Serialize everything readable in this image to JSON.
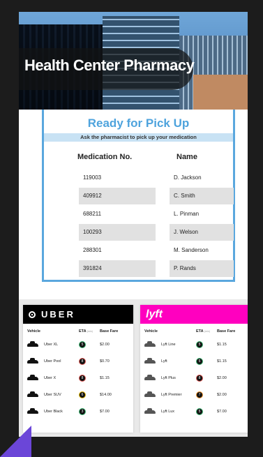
{
  "header": {
    "title": "Health Center Pharmacy"
  },
  "pickup": {
    "heading": "Ready for Pick Up",
    "instruction": "Ask the pharmacist to pick up your medication",
    "col_medication": "Medication No.",
    "col_name": "Name",
    "rows": [
      {
        "med": "119003",
        "name": "D. Jackson"
      },
      {
        "med": "409912",
        "name": "C. Smith"
      },
      {
        "med": "688211",
        "name": "L. Pinman"
      },
      {
        "med": "100293",
        "name": "J. Welson"
      },
      {
        "med": "288301",
        "name": "M. Sanderson"
      },
      {
        "med": "391824",
        "name": "P. Rands"
      }
    ]
  },
  "uber": {
    "brand": "UBER",
    "col_vehicle": "Vehicle",
    "col_eta": "ETA",
    "col_eta_unit": "(min)",
    "col_fare": "Base Fare",
    "rows": [
      {
        "vehicle": "Uber XL",
        "eta": "5",
        "fare": "$2.00"
      },
      {
        "vehicle": "Uber Pool",
        "eta": "8",
        "fare": "$0.70"
      },
      {
        "vehicle": "Uber X",
        "eta": "8",
        "fare": "$1.15"
      },
      {
        "vehicle": "Uber SUV",
        "eta": "6",
        "fare": "$14.00"
      },
      {
        "vehicle": "Uber Black",
        "eta": "3",
        "fare": "$7.00"
      }
    ]
  },
  "lyft": {
    "brand": "lyft",
    "col_vehicle": "Vehicle",
    "col_eta": "ETA",
    "col_eta_unit": "(min)",
    "col_fare": "Base Fare",
    "rows": [
      {
        "vehicle": "Lyft Line",
        "eta": "5",
        "fare": "$1.15"
      },
      {
        "vehicle": "Lyft",
        "eta": "5",
        "fare": "$1.15"
      },
      {
        "vehicle": "Lyft Plus",
        "eta": "8",
        "fare": "$2.00"
      },
      {
        "vehicle": "Lyft Premier",
        "eta": "7",
        "fare": "$2.00"
      },
      {
        "vehicle": "Lyft Lux",
        "eta": "5",
        "fare": "$7.00"
      }
    ]
  },
  "colors": {
    "accent": "#4ea3dd",
    "uber_bar": "#000000",
    "lyft_bar": "#ff00bf",
    "corner": "#6b46d8"
  }
}
